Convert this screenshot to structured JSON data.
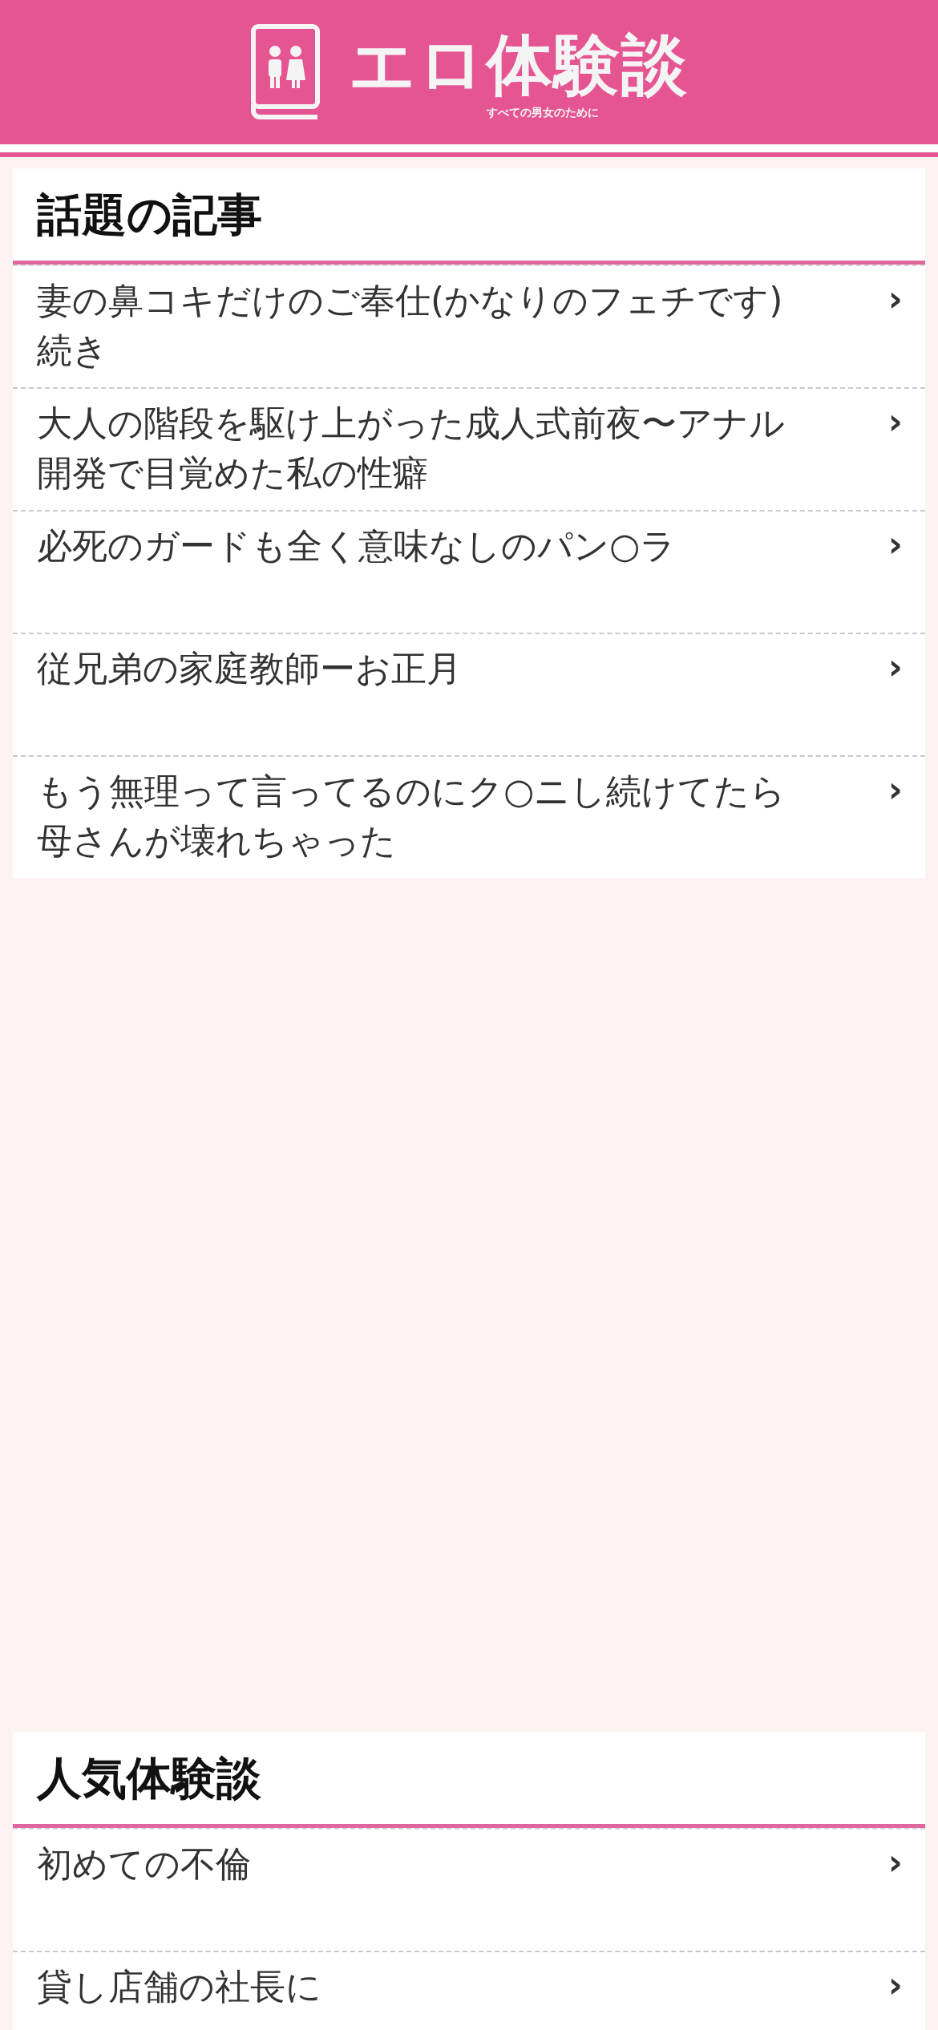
{
  "header": {
    "title": "エロ体験談",
    "tagline": "すべての男女のために"
  },
  "sections": [
    {
      "heading": "話題の記事",
      "items": [
        {
          "title": "妻の鼻コキだけのご奉仕(かなりのフェチです)続き",
          "chevron": "›"
        },
        {
          "title": "大人の階段を駆け上がった成人式前夜〜アナル開発で目覚めた私の性癖",
          "chevron": "›"
        },
        {
          "title": "必死のガードも全く意味なしのパン○ラ",
          "chevron": "›"
        },
        {
          "title": "従兄弟の家庭教師ーお正月",
          "chevron": "›"
        },
        {
          "title": "もう無理って言ってるのにク○ニし続けてたら母さんが壊れちゃった",
          "chevron": "›"
        }
      ]
    },
    {
      "heading": "人気体験談",
      "items": [
        {
          "title": "初めての不倫",
          "chevron": "›"
        },
        {
          "title": "貸し店舗の社長に",
          "chevron": "›"
        }
      ]
    }
  ]
}
